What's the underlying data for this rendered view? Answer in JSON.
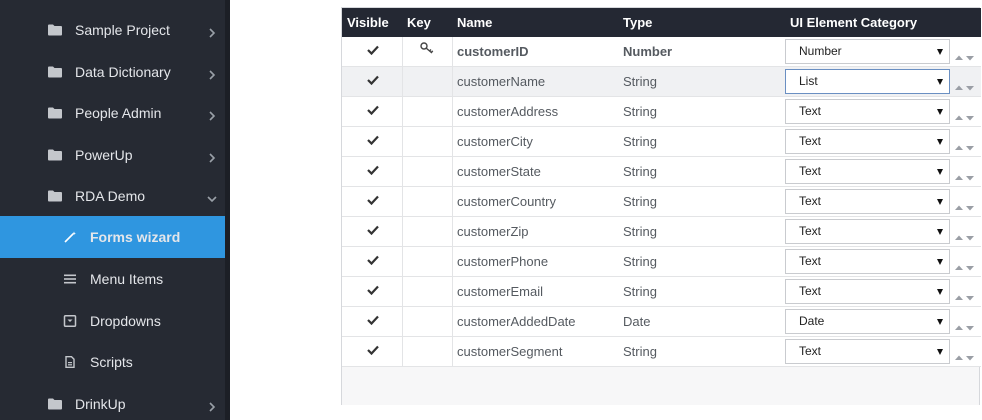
{
  "sidebar": {
    "items": [
      {
        "label": "Sample Project",
        "icon": "folder-icon",
        "chevron": "right"
      },
      {
        "label": "Data Dictionary",
        "icon": "folder-icon",
        "chevron": "right"
      },
      {
        "label": "People Admin",
        "icon": "folder-icon",
        "chevron": "right"
      },
      {
        "label": "PowerUp",
        "icon": "folder-icon",
        "chevron": "right"
      },
      {
        "label": "RDA Demo",
        "icon": "folder-icon",
        "chevron": "down"
      },
      {
        "label": "Forms wizard",
        "icon": "wand-icon",
        "active": true
      },
      {
        "label": "Menu Items",
        "icon": "menu-lines-icon"
      },
      {
        "label": "Dropdowns",
        "icon": "dropdown-box-icon"
      },
      {
        "label": "Scripts",
        "icon": "file-icon"
      },
      {
        "label": "DrinkUp",
        "icon": "folder-icon",
        "chevron": "right"
      }
    ],
    "colors": {
      "background": "#262a33",
      "active": "#2f96e0"
    }
  },
  "grid": {
    "headers": {
      "visible": "Visible",
      "key": "Key",
      "name": "Name",
      "type": "Type",
      "category": "UI Element Category"
    },
    "rows": [
      {
        "visible": true,
        "key": true,
        "name": "customerID",
        "type": "Number",
        "category": "Number"
      },
      {
        "visible": true,
        "key": false,
        "name": "customerName",
        "type": "String",
        "category": "List"
      },
      {
        "visible": true,
        "key": false,
        "name": "customerAddress",
        "type": "String",
        "category": "Text"
      },
      {
        "visible": true,
        "key": false,
        "name": "customerCity",
        "type": "String",
        "category": "Text"
      },
      {
        "visible": true,
        "key": false,
        "name": "customerState",
        "type": "String",
        "category": "Text"
      },
      {
        "visible": true,
        "key": false,
        "name": "customerCountry",
        "type": "String",
        "category": "Text"
      },
      {
        "visible": true,
        "key": false,
        "name": "customerZip",
        "type": "String",
        "category": "Text"
      },
      {
        "visible": true,
        "key": false,
        "name": "customerPhone",
        "type": "String",
        "category": "Text"
      },
      {
        "visible": true,
        "key": false,
        "name": "customerEmail",
        "type": "String",
        "category": "Text"
      },
      {
        "visible": true,
        "key": false,
        "name": "customerAddedDate",
        "type": "Date",
        "category": "Date"
      },
      {
        "visible": true,
        "key": false,
        "name": "customerSegment",
        "type": "String",
        "category": "Text"
      }
    ],
    "colors": {
      "header_bg": "#242833",
      "row_selected": "#f0f1f3"
    }
  }
}
